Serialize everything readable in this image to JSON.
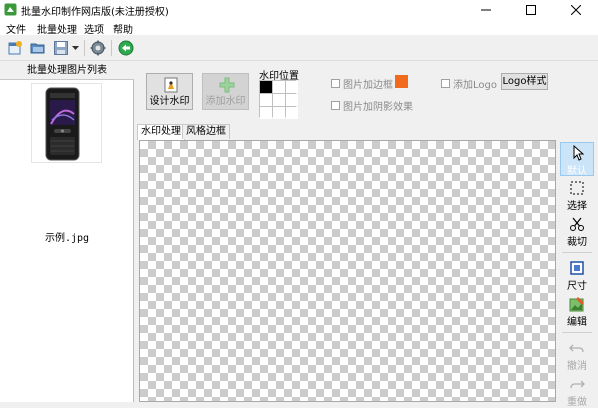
{
  "window": {
    "title": "批量水印制作网店版(未注册授权)",
    "controls": {
      "minimize": "—",
      "maximize": "☐",
      "close": "✕"
    }
  },
  "menu": {
    "items": [
      "文件",
      "批量处理",
      "选项",
      "帮助"
    ]
  },
  "toolbar": {
    "icons": [
      "new-project-icon",
      "open-folder-icon",
      "save-icon",
      "dropdown-arrow-icon",
      "settings-gear-icon",
      "globe-icon"
    ]
  },
  "left_panel": {
    "header": "批量处理图片列表",
    "images": [
      {
        "filename": "示例.jpg"
      }
    ]
  },
  "actions": {
    "design_watermark": "设计水印",
    "add_watermark": "添加水印"
  },
  "watermark_position": {
    "title": "水印位置",
    "selected": "top-left",
    "cells": [
      "top-left",
      "top-center",
      "top-right",
      "middle-left",
      "center",
      "middle-right",
      "bottom-left",
      "bottom-center",
      "bottom-right"
    ]
  },
  "options": {
    "border_label": "图片加边框",
    "border_color": "#f26b1d",
    "shadow_label": "图片加阴影效果",
    "logo_label": "添加Logo",
    "logo_style_button": "Logo样式"
  },
  "tabs": [
    "水印处理",
    "风格边框"
  ],
  "tools": {
    "pointer": "默认",
    "select": "选择",
    "crop": "裁切",
    "size": "尺寸",
    "edit": "编辑",
    "undo": "撤消",
    "redo": "重做"
  },
  "colors": {
    "accent": "#0078d7",
    "background": "#f0f0f0",
    "checker": "#cccccc"
  }
}
